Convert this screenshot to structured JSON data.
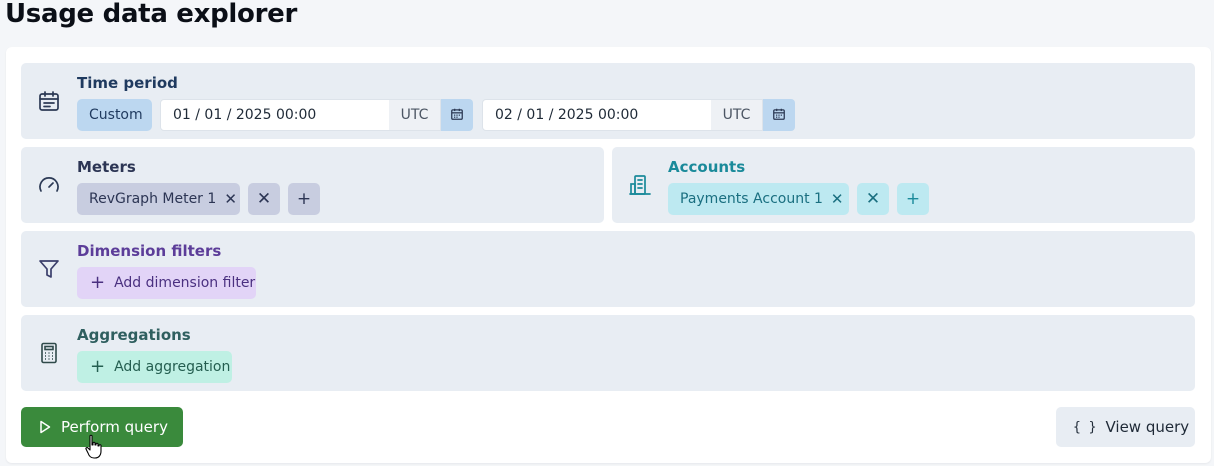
{
  "page": {
    "title": "Usage data explorer"
  },
  "time_period": {
    "title": "Time period",
    "preset": "Custom",
    "start": {
      "value": "01 / 01 / 2025 00:00",
      "tz": "UTC"
    },
    "end": {
      "value": "02 / 01 / 2025 00:00",
      "tz": "UTC"
    },
    "icon": "calendar-icon"
  },
  "meters": {
    "title": "Meters",
    "items": [
      {
        "label": "RevGraph Meter 1"
      }
    ],
    "icon": "gauge-icon"
  },
  "accounts": {
    "title": "Accounts",
    "items": [
      {
        "label": "Payments Account 1"
      }
    ],
    "icon": "building-icon"
  },
  "dimension_filters": {
    "title": "Dimension filters",
    "add_label": "Add dimension filter",
    "icon": "filter-icon"
  },
  "aggregations": {
    "title": "Aggregations",
    "add_label": "Add aggregation",
    "icon": "calculator-icon"
  },
  "actions": {
    "perform_label": "Perform query",
    "view_label": "View query",
    "view_icon_glyph": "{ }"
  },
  "colors": {
    "time_title": "#1f3a5f",
    "meters_title": "#2c3554",
    "accounts_title": "#1a8a9a",
    "dimension_title": "#5c3d99",
    "aggregation_title": "#2f5f5f",
    "primary": "#3a8a3c"
  }
}
